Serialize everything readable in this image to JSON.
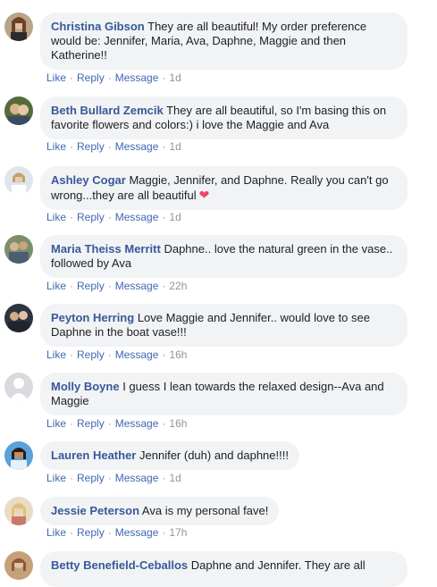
{
  "actions": {
    "like": "Like",
    "reply": "Reply",
    "message": "Message",
    "separator": "·"
  },
  "comments": [
    {
      "author": "Christina Gibson",
      "text": "They are all beautiful! My order preference would be: Jennifer, Maria, Ava, Daphne, Maggie and then Katherine!!",
      "time": "1d"
    },
    {
      "author": "Beth Bullard Zemcik",
      "text": "They are all beautiful, so I'm basing this on favorite flowers and colors:) i love the Maggie and Ava",
      "time": "1d"
    },
    {
      "author": "Ashley Cogar",
      "text": "Maggie, Jennifer, and Daphne. Really you can't go wrong...they are all beautiful",
      "emoji": "heart-emoji",
      "time": "1d"
    },
    {
      "author": "Maria Theiss Merritt",
      "text": "Daphne.. love the natural green in the vase.. followed by Ava",
      "time": "22h"
    },
    {
      "author": "Peyton Herring",
      "text": "Love Maggie and Jennifer.. would love to see Daphne in the boat vase!!!",
      "time": "16h"
    },
    {
      "author": "Molly Boyne",
      "text": "I guess I lean towards the relaxed design--Ava and Maggie",
      "time": "16h"
    },
    {
      "author": "Lauren Heather",
      "text": "Jennifer (duh) and daphne!!!!",
      "time": "1d"
    },
    {
      "author": "Jessie Peterson",
      "text": "Ava is my personal fave!",
      "time": "17h"
    },
    {
      "author": "Betty Benefield-Ceballos",
      "text": "Daphne and Jennifer. They are all",
      "time": ""
    }
  ],
  "colors": {
    "author": "#385898",
    "link": "#4267b2",
    "bubble": "#f2f3f5",
    "heart": "#f0446a"
  }
}
